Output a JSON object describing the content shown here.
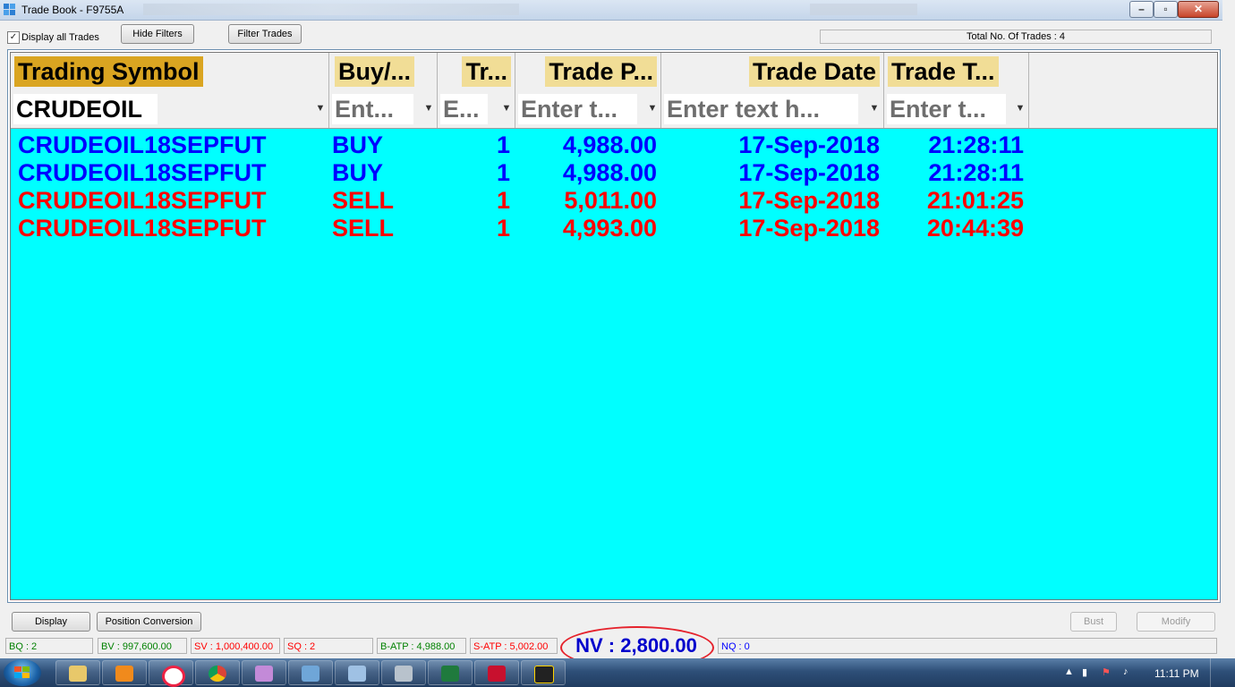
{
  "window": {
    "title": "Trade Book - F9755A"
  },
  "toolbar": {
    "display_all_label": "Display all Trades",
    "display_all_checked": true,
    "hide_filters_label": "Hide Filters",
    "filter_trades_label": "Filter Trades",
    "total_trades_text": "Total No. Of Trades : 4"
  },
  "grid": {
    "columns": [
      "Trading Symbol",
      "Buy/...",
      "Tr...",
      "Trade P...",
      "Trade Date",
      "Trade T..."
    ],
    "filters": [
      "CRUDEOIL",
      "Ent...",
      "E...",
      "Enter t...",
      "Enter text h...",
      "Enter t..."
    ],
    "rows": [
      {
        "symbol": "CRUDEOIL18SEPFUT",
        "side": "BUY",
        "qty": "1",
        "price": "4,988.00",
        "date": "17-Sep-2018",
        "time": "21:28:11"
      },
      {
        "symbol": "CRUDEOIL18SEPFUT",
        "side": "BUY",
        "qty": "1",
        "price": "4,988.00",
        "date": "17-Sep-2018",
        "time": "21:28:11"
      },
      {
        "symbol": "CRUDEOIL18SEPFUT",
        "side": "SELL",
        "qty": "1",
        "price": "5,011.00",
        "date": "17-Sep-2018",
        "time": "21:01:25"
      },
      {
        "symbol": "CRUDEOIL18SEPFUT",
        "side": "SELL",
        "qty": "1",
        "price": "4,993.00",
        "date": "17-Sep-2018",
        "time": "20:44:39"
      }
    ],
    "background_color": "#00ffff",
    "buy_color": "#0000ff",
    "sell_color": "#ff0000"
  },
  "footer": {
    "display_label": "Display",
    "position_conversion_label": "Position Conversion",
    "bust_label": "Bust",
    "modify_label": "Modify"
  },
  "stats": {
    "bq": "BQ : 2",
    "bv": "BV : 997,600.00",
    "sv": "SV : 1,000,400.00",
    "sq": "SQ : 2",
    "batp": "B-ATP : 4,988.00",
    "satp": "S-ATP : 5,002.00",
    "nv": "NV : 2,800.00",
    "nq": "NQ : 0"
  },
  "taskbar": {
    "clock": "11:11 PM",
    "icons": [
      "windows-start-icon",
      "file-explorer-icon",
      "media-player-icon",
      "lifebuoy-icon",
      "chrome-icon",
      "triangle-app-icon",
      "folder-app-icon",
      "window-app-icon",
      "calculator-icon",
      "excel-icon",
      "pdf-icon",
      "chart-app-icon"
    ]
  }
}
